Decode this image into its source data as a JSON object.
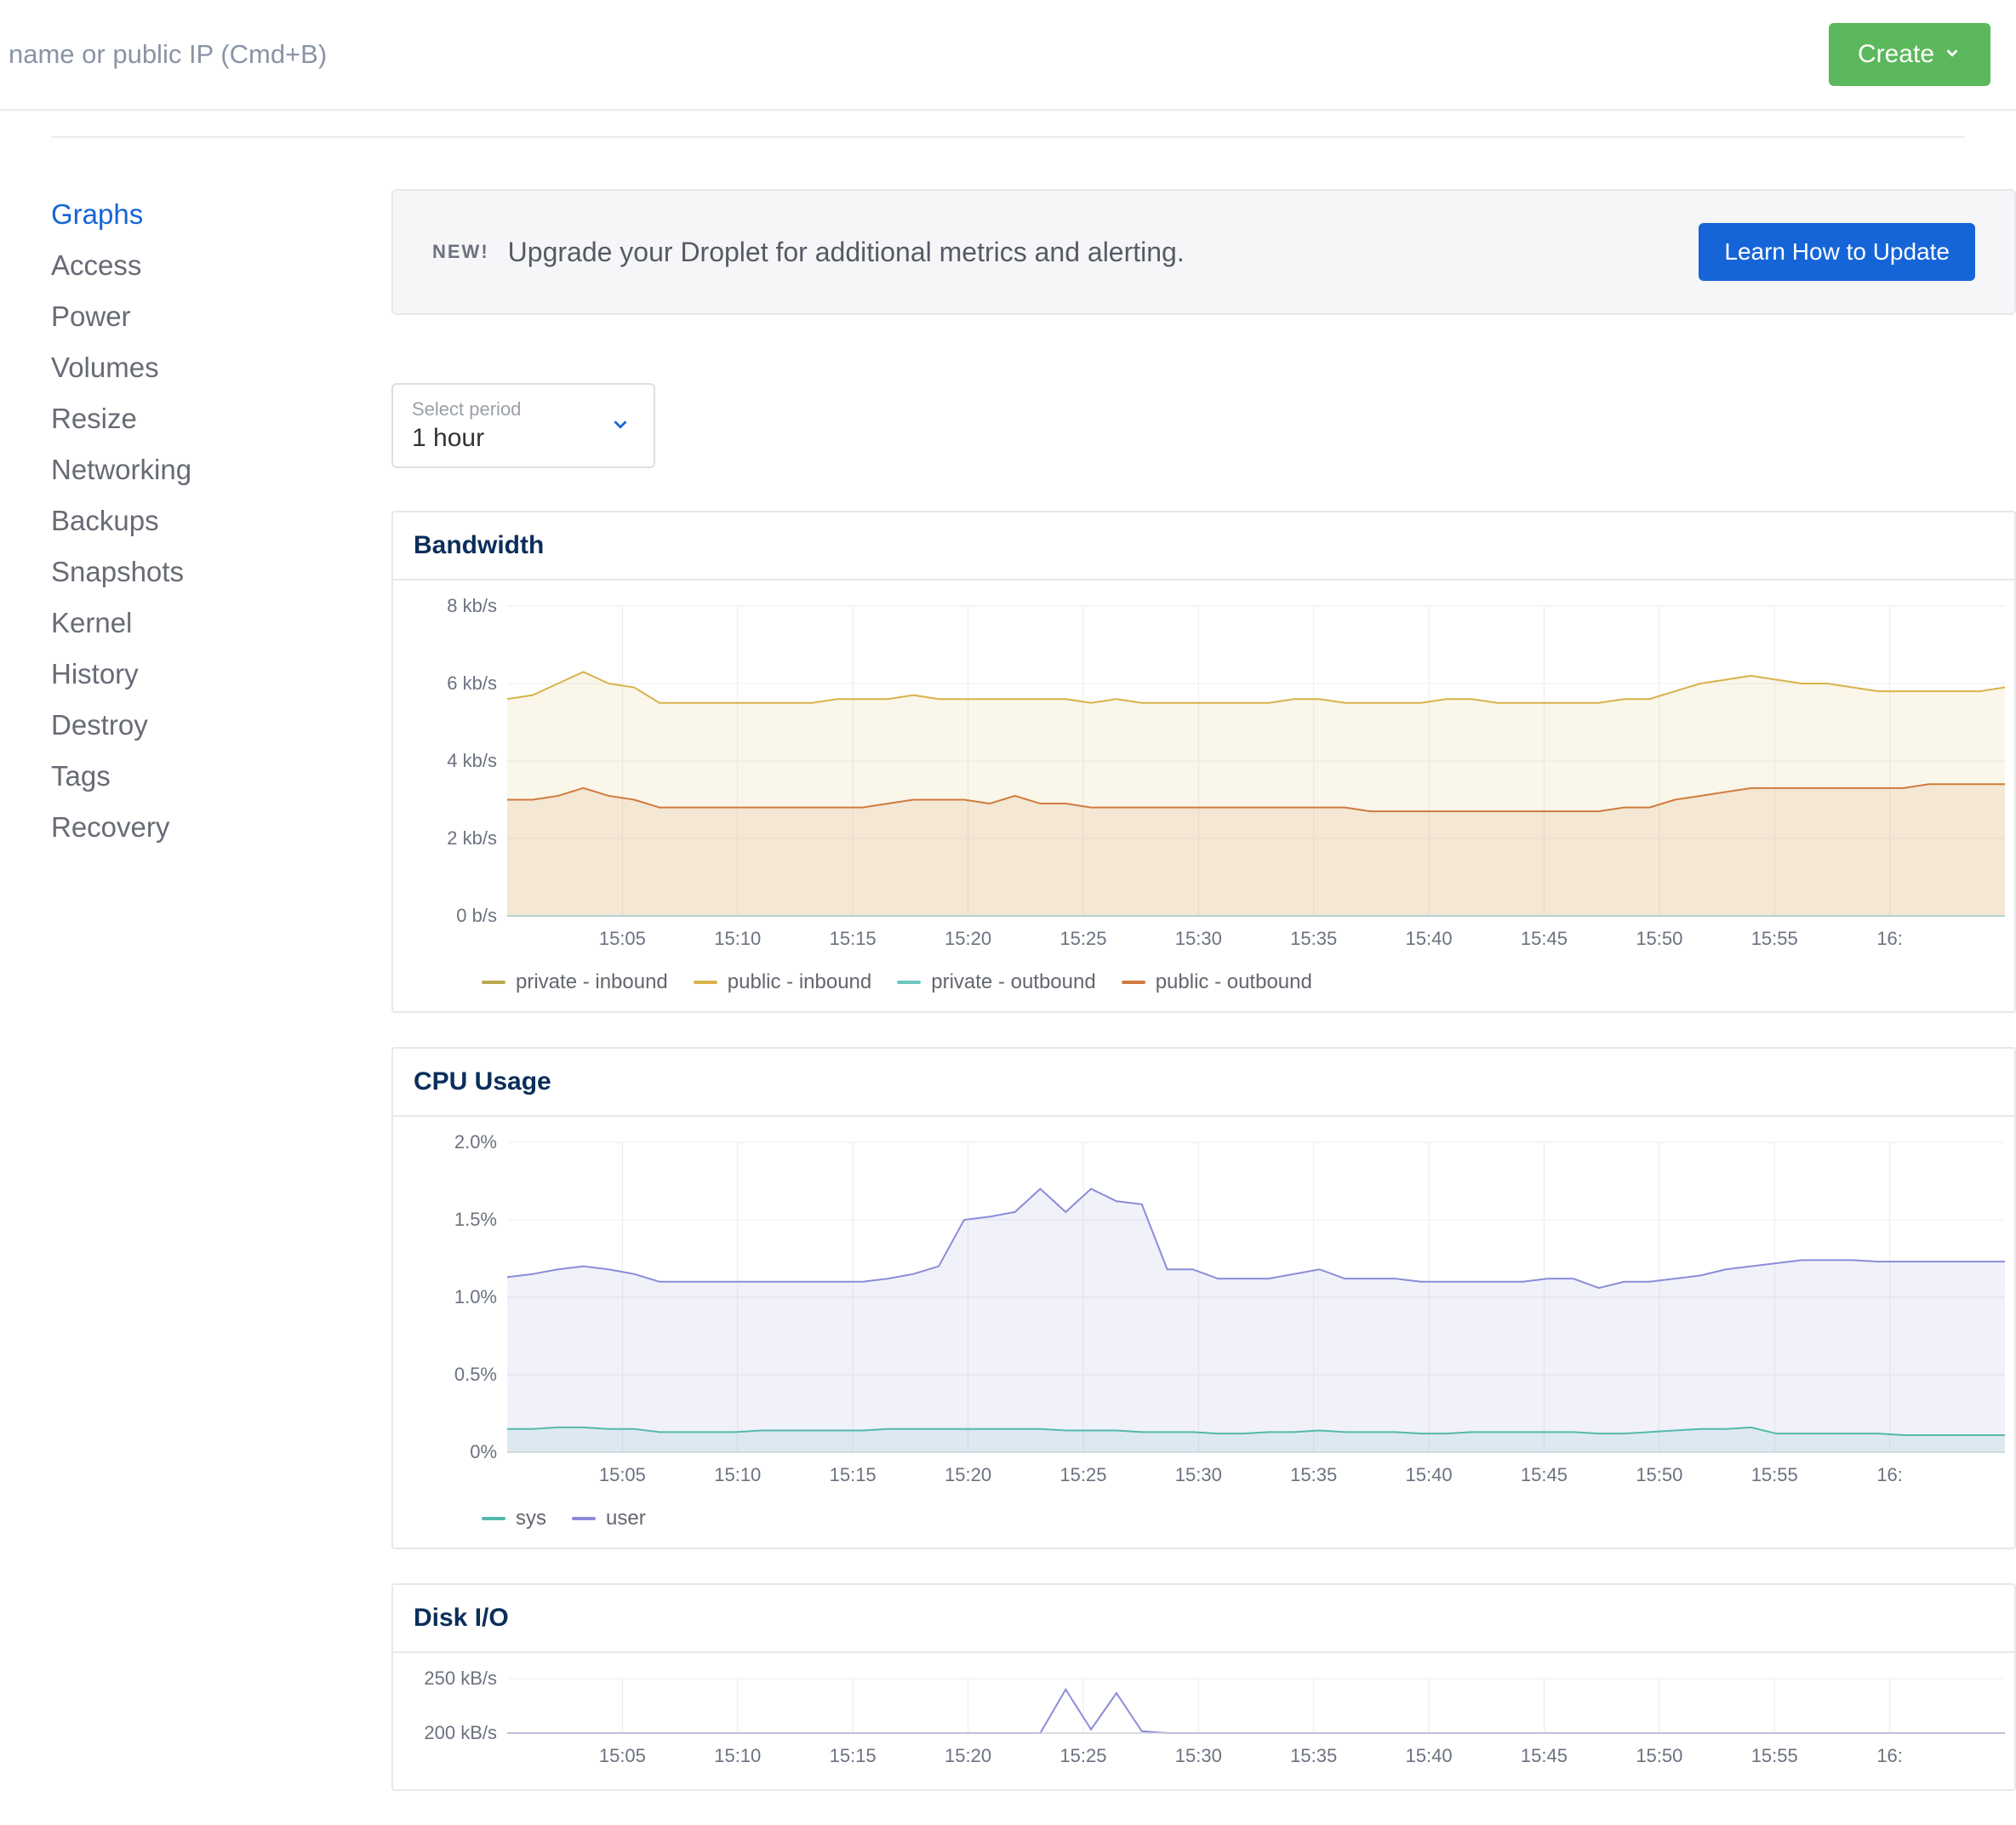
{
  "header": {
    "search_placeholder": "name or public IP (Cmd+B)",
    "create_label": "Create"
  },
  "sidebar": {
    "items": [
      {
        "label": "Graphs",
        "active": true
      },
      {
        "label": "Access"
      },
      {
        "label": "Power"
      },
      {
        "label": "Volumes"
      },
      {
        "label": "Resize"
      },
      {
        "label": "Networking"
      },
      {
        "label": "Backups"
      },
      {
        "label": "Snapshots"
      },
      {
        "label": "Kernel"
      },
      {
        "label": "History"
      },
      {
        "label": "Destroy"
      },
      {
        "label": "Tags"
      },
      {
        "label": "Recovery"
      }
    ]
  },
  "banner": {
    "new_badge": "NEW!",
    "text": "Upgrade your Droplet for additional metrics and alerting.",
    "button": "Learn How to Update"
  },
  "period": {
    "label": "Select period",
    "value": "1 hour"
  },
  "chart_data": [
    {
      "type": "area",
      "title": "Bandwidth",
      "x_ticks": [
        "15:05",
        "15:10",
        "15:15",
        "15:20",
        "15:25",
        "15:30",
        "15:35",
        "15:40",
        "15:45",
        "15:50",
        "15:55",
        "16:"
      ],
      "y_ticks": [
        "0 b/s",
        "2 kb/s",
        "4 kb/s",
        "6 kb/s",
        "8 kb/s"
      ],
      "ylim": [
        0,
        8
      ],
      "yunit": "kb/s",
      "legend": [
        "private - inbound",
        "public - inbound",
        "private - outbound",
        "public - outbound"
      ],
      "colors": {
        "private - inbound": "#b8a94d",
        "public - inbound": "#d8b24a",
        "private - outbound": "#6ac7c2",
        "public - outbound": "#d07a3f"
      },
      "series": [
        {
          "name": "public - inbound",
          "values": [
            5.6,
            5.7,
            6.0,
            6.3,
            6.0,
            5.9,
            5.5,
            5.5,
            5.5,
            5.5,
            5.5,
            5.5,
            5.5,
            5.6,
            5.6,
            5.6,
            5.7,
            5.6,
            5.6,
            5.6,
            5.6,
            5.6,
            5.6,
            5.5,
            5.6,
            5.5,
            5.5,
            5.5,
            5.5,
            5.5,
            5.5,
            5.6,
            5.6,
            5.5,
            5.5,
            5.5,
            5.5,
            5.6,
            5.6,
            5.5,
            5.5,
            5.5,
            5.5,
            5.5,
            5.6,
            5.6,
            5.8,
            6.0,
            6.1,
            6.2,
            6.1,
            6.0,
            6.0,
            5.9,
            5.8,
            5.8,
            5.8,
            5.8,
            5.8,
            5.9
          ]
        },
        {
          "name": "public - outbound",
          "values": [
            3.0,
            3.0,
            3.1,
            3.3,
            3.1,
            3.0,
            2.8,
            2.8,
            2.8,
            2.8,
            2.8,
            2.8,
            2.8,
            2.8,
            2.8,
            2.9,
            3.0,
            3.0,
            3.0,
            2.9,
            3.1,
            2.9,
            2.9,
            2.8,
            2.8,
            2.8,
            2.8,
            2.8,
            2.8,
            2.8,
            2.8,
            2.8,
            2.8,
            2.8,
            2.7,
            2.7,
            2.7,
            2.7,
            2.7,
            2.7,
            2.7,
            2.7,
            2.7,
            2.7,
            2.8,
            2.8,
            3.0,
            3.1,
            3.2,
            3.3,
            3.3,
            3.3,
            3.3,
            3.3,
            3.3,
            3.3,
            3.4,
            3.4,
            3.4,
            3.4
          ]
        },
        {
          "name": "private - inbound",
          "values": [
            0,
            0,
            0,
            0,
            0,
            0,
            0,
            0,
            0,
            0,
            0,
            0,
            0,
            0,
            0,
            0,
            0,
            0,
            0,
            0,
            0,
            0,
            0,
            0,
            0,
            0,
            0,
            0,
            0,
            0,
            0,
            0,
            0,
            0,
            0,
            0,
            0,
            0,
            0,
            0,
            0,
            0,
            0,
            0,
            0,
            0,
            0,
            0,
            0,
            0,
            0,
            0,
            0,
            0,
            0,
            0,
            0,
            0,
            0,
            0
          ]
        },
        {
          "name": "private - outbound",
          "values": [
            0,
            0,
            0,
            0,
            0,
            0,
            0,
            0,
            0,
            0,
            0,
            0,
            0,
            0,
            0,
            0,
            0,
            0,
            0,
            0,
            0,
            0,
            0,
            0,
            0,
            0,
            0,
            0,
            0,
            0,
            0,
            0,
            0,
            0,
            0,
            0,
            0,
            0,
            0,
            0,
            0,
            0,
            0,
            0,
            0,
            0,
            0,
            0,
            0,
            0,
            0,
            0,
            0,
            0,
            0,
            0,
            0,
            0,
            0,
            0
          ]
        }
      ]
    },
    {
      "type": "area",
      "title": "CPU Usage",
      "x_ticks": [
        "15:05",
        "15:10",
        "15:15",
        "15:20",
        "15:25",
        "15:30",
        "15:35",
        "15:40",
        "15:45",
        "15:50",
        "15:55",
        "16:"
      ],
      "y_ticks": [
        "0%",
        "0.5%",
        "1.0%",
        "1.5%",
        "2.0%"
      ],
      "ylim": [
        0,
        2.0
      ],
      "yunit": "%",
      "legend": [
        "sys",
        "user"
      ],
      "colors": {
        "sys": "#55b9aa",
        "user": "#8b8cd9"
      },
      "series": [
        {
          "name": "user",
          "values": [
            1.13,
            1.15,
            1.18,
            1.2,
            1.18,
            1.15,
            1.1,
            1.1,
            1.1,
            1.1,
            1.1,
            1.1,
            1.1,
            1.1,
            1.1,
            1.12,
            1.15,
            1.2,
            1.5,
            1.52,
            1.55,
            1.7,
            1.55,
            1.7,
            1.62,
            1.6,
            1.18,
            1.18,
            1.12,
            1.12,
            1.12,
            1.15,
            1.18,
            1.12,
            1.12,
            1.12,
            1.1,
            1.1,
            1.1,
            1.1,
            1.1,
            1.12,
            1.12,
            1.06,
            1.1,
            1.1,
            1.12,
            1.14,
            1.18,
            1.2,
            1.22,
            1.24,
            1.24,
            1.24,
            1.23,
            1.23,
            1.23,
            1.23,
            1.23,
            1.23
          ]
        },
        {
          "name": "sys",
          "values": [
            0.15,
            0.15,
            0.16,
            0.16,
            0.15,
            0.15,
            0.13,
            0.13,
            0.13,
            0.13,
            0.14,
            0.14,
            0.14,
            0.14,
            0.14,
            0.15,
            0.15,
            0.15,
            0.15,
            0.15,
            0.15,
            0.15,
            0.14,
            0.14,
            0.14,
            0.13,
            0.13,
            0.13,
            0.12,
            0.12,
            0.13,
            0.13,
            0.14,
            0.13,
            0.13,
            0.13,
            0.12,
            0.12,
            0.13,
            0.13,
            0.13,
            0.13,
            0.13,
            0.12,
            0.12,
            0.13,
            0.14,
            0.15,
            0.15,
            0.16,
            0.12,
            0.12,
            0.12,
            0.12,
            0.12,
            0.11,
            0.11,
            0.11,
            0.11,
            0.11
          ]
        }
      ]
    },
    {
      "type": "line",
      "title": "Disk I/O",
      "x_ticks": [
        "15:05",
        "15:10",
        "15:15",
        "15:20",
        "15:25",
        "15:30",
        "15:35",
        "15:40",
        "15:45",
        "15:50",
        "15:55",
        "16:"
      ],
      "y_ticks": [
        "200 kB/s",
        "250 kB/s"
      ],
      "ylim": [
        0,
        300
      ],
      "yunit": "kB/s",
      "legend": [],
      "colors": {
        "disk": "#8b8cd9"
      },
      "series": [
        {
          "name": "disk",
          "values": [
            0,
            0,
            0,
            0,
            0,
            0,
            0,
            0,
            0,
            0,
            0,
            0,
            0,
            0,
            0,
            0,
            0,
            0,
            0,
            0,
            0,
            0,
            240,
            20,
            220,
            10,
            0,
            0,
            0,
            0,
            0,
            0,
            0,
            0,
            0,
            0,
            0,
            0,
            0,
            0,
            0,
            0,
            0,
            0,
            0,
            0,
            0,
            0,
            0,
            0,
            0,
            0,
            0,
            0,
            0,
            0,
            0,
            0,
            0,
            0
          ]
        }
      ]
    }
  ]
}
